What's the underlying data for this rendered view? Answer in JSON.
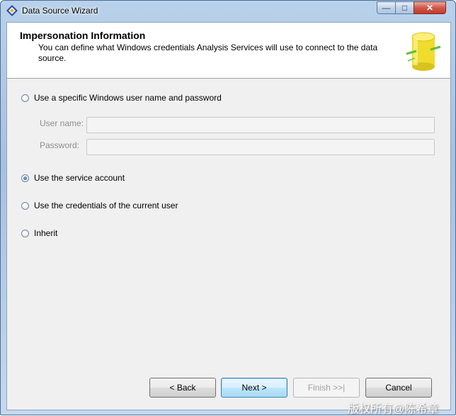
{
  "window": {
    "title": "Data Source Wizard"
  },
  "window_controls": {
    "minimize": "—",
    "maximize": "□",
    "close": "✕"
  },
  "header": {
    "title": "Impersonation Information",
    "description": "You can define what Windows credentials Analysis Services will use to connect to the data source."
  },
  "options": {
    "specific_user": "Use a specific Windows user name and password",
    "service_account": "Use the service account",
    "current_user": "Use the credentials of the current user",
    "inherit": "Inherit",
    "selected": "service_account"
  },
  "fields": {
    "username_label": "User name:",
    "username_value": "",
    "password_label": "Password:",
    "password_value": ""
  },
  "buttons": {
    "back": "< Back",
    "next": "Next >",
    "finish": "Finish >>|",
    "cancel": "Cancel"
  },
  "watermark": "版权所有@陈希章",
  "icons": {
    "app": "diamond-app-icon",
    "header_art": "database-cylinder-icon"
  },
  "colors": {
    "titlebar": "#a6c1df",
    "dialog_bg": "#f0f0f0",
    "close_button": "#c23a2a",
    "radio_selected": "#1c4f9a",
    "database_yellow": "#f5e23a"
  }
}
